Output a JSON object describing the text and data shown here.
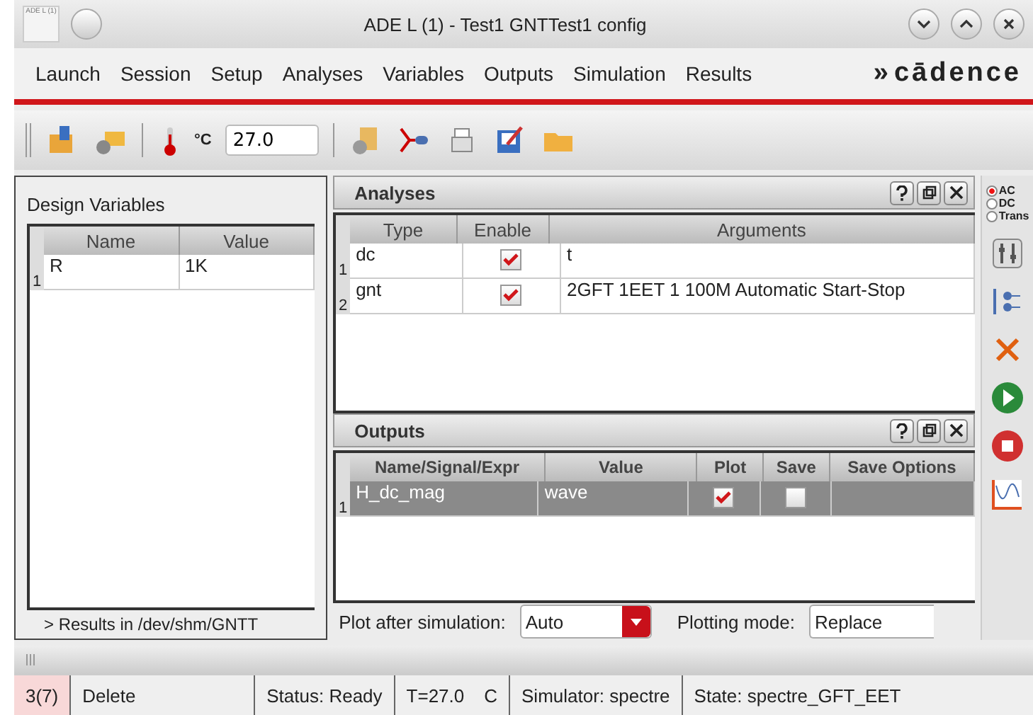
{
  "window": {
    "title": "ADE L (1) - Test1 GNTTest1 config",
    "app_icon": "ADE L (1)"
  },
  "menu": [
    {
      "label": "Launch"
    },
    {
      "label": "Session"
    },
    {
      "label": "Setup"
    },
    {
      "label": "Analyses"
    },
    {
      "label": "Variables"
    },
    {
      "label": "Outputs"
    },
    {
      "label": "Simulation"
    },
    {
      "label": "Results"
    }
  ],
  "logo": {
    "prefix": "»",
    "text": "cādence"
  },
  "toolbar": {
    "temperature": "27.0",
    "unit": "°C"
  },
  "design_variables": {
    "title": "Design Variables",
    "columns": [
      "Name",
      "Value"
    ],
    "rows": [
      {
        "index": "1",
        "cells": [
          "R",
          "1K"
        ]
      }
    ],
    "footer": "> Results in /dev/shm/GNTT"
  },
  "analyses": {
    "title": "Analyses",
    "columns": [
      "Type",
      "Enable",
      "Arguments"
    ],
    "rows": [
      {
        "index": "1",
        "type": "dc",
        "enabled": true,
        "arguments": "t"
      },
      {
        "index": "2",
        "type": "gnt",
        "enabled": true,
        "arguments": "2GFT 1EET 1 100M Automatic Start-Stop"
      }
    ]
  },
  "outputs": {
    "title": "Outputs",
    "columns": [
      "Name/Signal/Expr",
      "Value",
      "Plot",
      "Save",
      "Save Options"
    ],
    "rows": [
      {
        "index": "1",
        "name": "H_dc_mag",
        "value": "wave",
        "plot": true,
        "save": false,
        "selected": true
      }
    ],
    "plot_after_label": "Plot after simulation:",
    "plot_after": "Auto",
    "plotting_mode_label": "Plotting mode:",
    "plotting_mode": "Replace"
  },
  "analysis_modes": [
    {
      "label": "AC",
      "selected": true
    },
    {
      "label": "DC",
      "selected": false
    },
    {
      "label": "Trans",
      "selected": false
    }
  ],
  "status_bar": {
    "count": "3(7)",
    "command": "Delete",
    "status": "Status: Ready",
    "temperature": "T=27.0",
    "unit": "C",
    "simulator": "Simulator: spectre",
    "state": "State: spectre_GFT_EET"
  }
}
